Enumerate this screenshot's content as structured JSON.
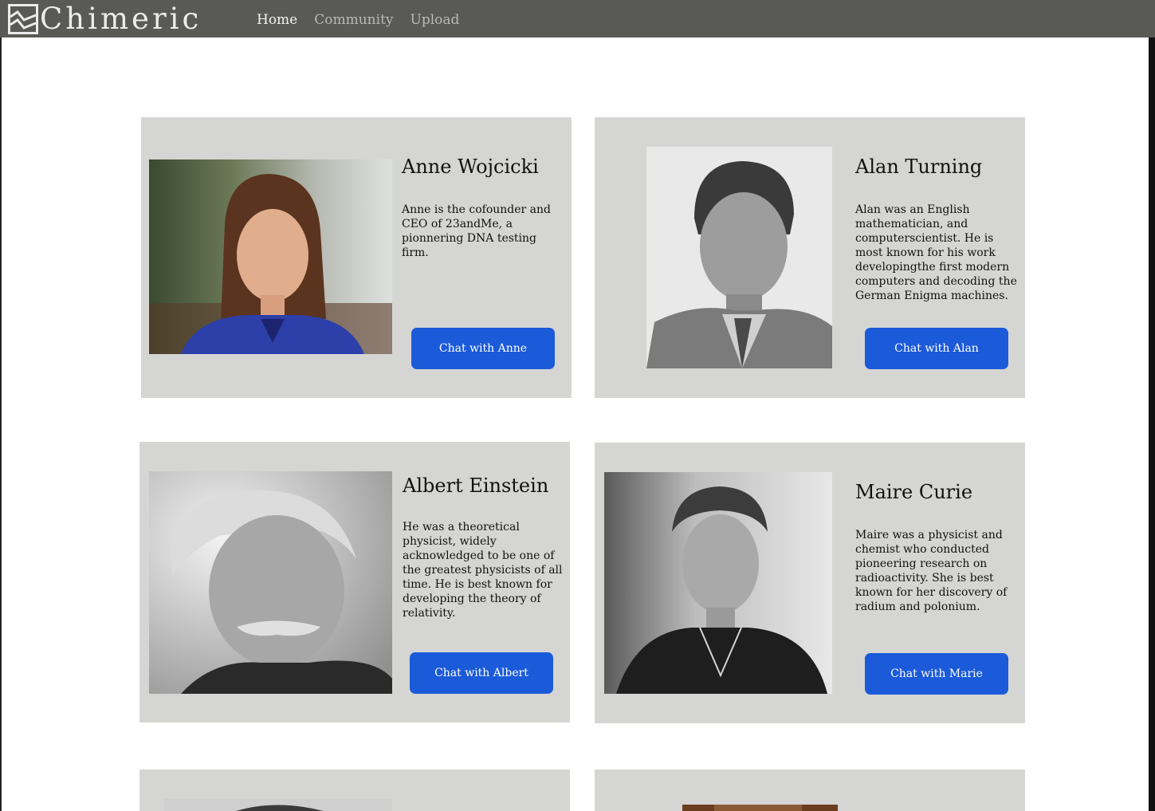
{
  "app": {
    "name": "Chimeric",
    "nav": [
      {
        "label": "Home",
        "active": true
      },
      {
        "label": "Community",
        "active": false
      },
      {
        "label": "Upload",
        "active": false
      }
    ]
  },
  "colors": {
    "navbar": "#595a56",
    "card": "#d5d5d3",
    "button": "#1b5ad9"
  },
  "cards": [
    {
      "name": "Anne Wojcicki",
      "description": "Anne is the cofounder and CEO of 23andMe, a pionnering DNA testing firm.",
      "button": "Chat with Anne",
      "photo": "anne-wojcicki-photo"
    },
    {
      "name": "Alan Turning",
      "description": "Alan was an English mathematician, and computerscientist. He is most known for his work developingthe first modern computers and decoding the German Enigma machines.",
      "button": "Chat with Alan",
      "photo": "alan-turing-photo"
    },
    {
      "name": "Albert Einstein",
      "description": "He was a theoretical physicist, widely acknowledged to be one of the greatest physicists of all time. He is best known for developing the theory of relativity.",
      "button": "Chat with Albert",
      "photo": "albert-einstein-photo"
    },
    {
      "name": "Maire Curie",
      "description": "Maire was a physicist and chemist who conducted pioneering research on radioactivity. She is best known for her discovery of radium and polonium.",
      "button": "Chat with Marie",
      "photo": "marie-curie-photo"
    }
  ]
}
